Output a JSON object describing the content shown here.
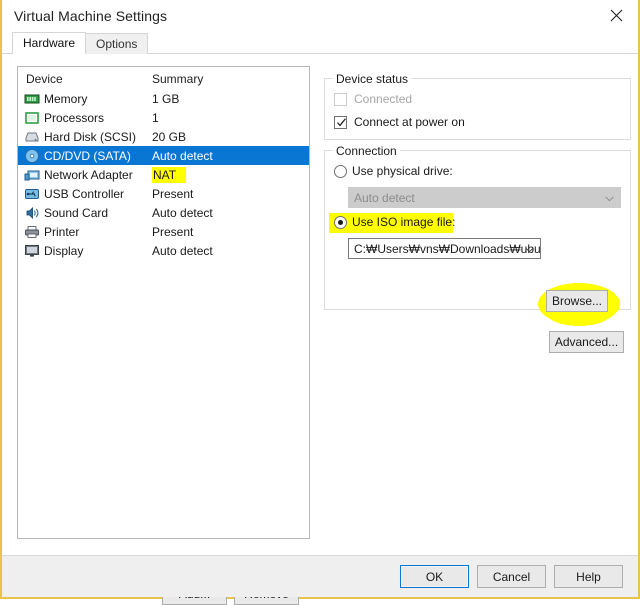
{
  "window": {
    "title": "Virtual Machine Settings",
    "close_icon": "close-icon"
  },
  "tabs": [
    {
      "label": "Hardware",
      "active": true
    },
    {
      "label": "Options",
      "active": false
    }
  ],
  "device_list": {
    "columns": {
      "device": "Device",
      "summary": "Summary"
    },
    "rows": [
      {
        "icon": "memory-icon",
        "device": "Memory",
        "summary": "1 GB",
        "selected": false,
        "highlight": false
      },
      {
        "icon": "processor-icon",
        "device": "Processors",
        "summary": "1",
        "selected": false,
        "highlight": false
      },
      {
        "icon": "hard-disk-icon",
        "device": "Hard Disk (SCSI)",
        "summary": "20 GB",
        "selected": false,
        "highlight": false
      },
      {
        "icon": "cd-dvd-icon",
        "device": "CD/DVD (SATA)",
        "summary": "Auto detect",
        "selected": true,
        "highlight": false
      },
      {
        "icon": "network-adapter-icon",
        "device": "Network Adapter",
        "summary": "NAT",
        "selected": false,
        "highlight": true
      },
      {
        "icon": "usb-controller-icon",
        "device": "USB Controller",
        "summary": "Present",
        "selected": false,
        "highlight": false
      },
      {
        "icon": "sound-card-icon",
        "device": "Sound Card",
        "summary": "Auto detect",
        "selected": false,
        "highlight": false
      },
      {
        "icon": "printer-icon",
        "device": "Printer",
        "summary": "Present",
        "selected": false,
        "highlight": false
      },
      {
        "icon": "display-icon",
        "device": "Display",
        "summary": "Auto detect",
        "selected": false,
        "highlight": false
      }
    ],
    "add_label": "Add...",
    "remove_label": "Remove"
  },
  "device_status": {
    "group_label": "Device status",
    "connected_label": "Connected",
    "connected_checked": false,
    "connected_disabled": true,
    "connect_at_power_on_label": "Connect at power on",
    "connect_at_power_on_checked": true
  },
  "connection": {
    "group_label": "Connection",
    "physical_drive_label": "Use physical drive:",
    "physical_drive_selected": false,
    "physical_drive_value": "Auto detect",
    "physical_drive_disabled": true,
    "iso_label": "Use ISO image file:",
    "iso_selected": true,
    "iso_path": "C:₩Users₩vns₩Downloads₩ubur",
    "browse_label": "Browse...",
    "advanced_label": "Advanced..."
  },
  "footer": {
    "ok_label": "OK",
    "cancel_label": "Cancel",
    "help_label": "Help"
  },
  "colors": {
    "selection_blue": "#0a76d4",
    "highlighter_yellow": "#ffff00",
    "window_frame": "#e8c44d",
    "footer_bg": "#efefef"
  }
}
